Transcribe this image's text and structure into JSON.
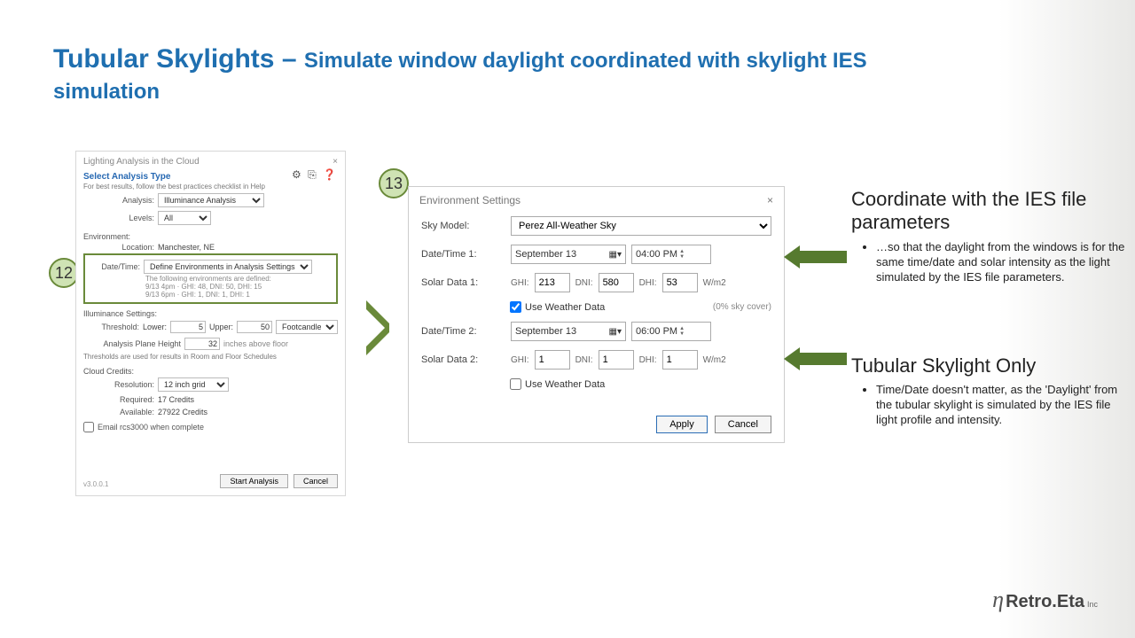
{
  "title": {
    "main": "Tubular Skylights – ",
    "sub": "Simulate window daylight coordinated with skylight IES",
    "line2": "simulation"
  },
  "badge12": "12",
  "badge13": "13",
  "left": {
    "window_title": "Lighting Analysis in the Cloud",
    "close": "×",
    "section1": "Select Analysis Type",
    "settings_icons": "⚙ ⎘ ❓",
    "best_note": "For best results, follow the best practices checklist in Help",
    "analysis_lbl": "Analysis:",
    "analysis_val": "Illuminance Analysis",
    "levels_lbl": "Levels:",
    "levels_val": "All",
    "env_hdr": "Environment:",
    "loc_lbl": "Location:",
    "loc_val": "Manchester, NE",
    "dt_lbl": "Date/Time:",
    "dt_val": "Define Environments in Analysis Settings",
    "env_note1": "The following environments are defined:",
    "env_note2": "9/13 4pm · GHI: 48, DNI: 50, DHI: 15",
    "env_note3": "9/13 6pm · GHI: 1, DNI: 1, DHI: 1",
    "ill_hdr": "Illuminance Settings:",
    "thr_lbl": "Threshold:",
    "lower_lbl": "Lower:",
    "lower_val": "5",
    "upper_lbl": "Upper:",
    "upper_val": "50",
    "units_val": "Footcandles",
    "plane_lbl": "Analysis Plane Height",
    "plane_val": "32",
    "plane_unit": "inches above floor",
    "sched_note": "Thresholds are used for results in Room and Floor Schedules",
    "cloud_hdr": "Cloud Credits:",
    "res_lbl": "Resolution:",
    "res_val": "12 inch grid",
    "req_lbl": "Required:",
    "req_val": "17 Credits",
    "avail_lbl": "Available:",
    "avail_val": "27922 Credits",
    "email_chk": "Email rcs3000 when complete",
    "start_btn": "Start Analysis",
    "cancel_btn": "Cancel",
    "version": "v3.0.0.1"
  },
  "right": {
    "window_title": "Environment Settings",
    "close": "×",
    "sky_lbl": "Sky Model:",
    "sky_val": "Perez All-Weather Sky",
    "dt1_lbl": "Date/Time 1:",
    "dt1_date": "September 13",
    "dt1_time": "04:00 PM",
    "sd1_lbl": "Solar Data 1:",
    "sd1_ghi_lbl": "GHI:",
    "sd1_ghi": "213",
    "sd1_dni_lbl": "DNI:",
    "sd1_dni": "580",
    "sd1_dhi_lbl": "DHI:",
    "sd1_dhi": "53",
    "wm2": "W/m2",
    "use_wx": "Use Weather Data",
    "sky_cover": "(0% sky cover)",
    "dt2_lbl": "Date/Time 2:",
    "dt2_date": "September 13",
    "dt2_time": "06:00 PM",
    "sd2_lbl": "Solar Data 2:",
    "sd2_ghi": "1",
    "sd2_dni": "1",
    "sd2_dhi": "1",
    "apply": "Apply",
    "cancel": "Cancel"
  },
  "explain1_h": "Coordinate with the IES file parameters",
  "explain1_b": "…so that the daylight from the windows is for the same time/date and solar intensity as the light simulated by the IES file parameters.",
  "explain2_h": "Tubular Skylight Only",
  "explain2_b": "Time/Date doesn't matter, as the 'Daylight' from the tubular skylight is simulated by the IES file light profile and intensity.",
  "logo_retro": "Retro.Eta",
  "logo_inc": "Inc"
}
